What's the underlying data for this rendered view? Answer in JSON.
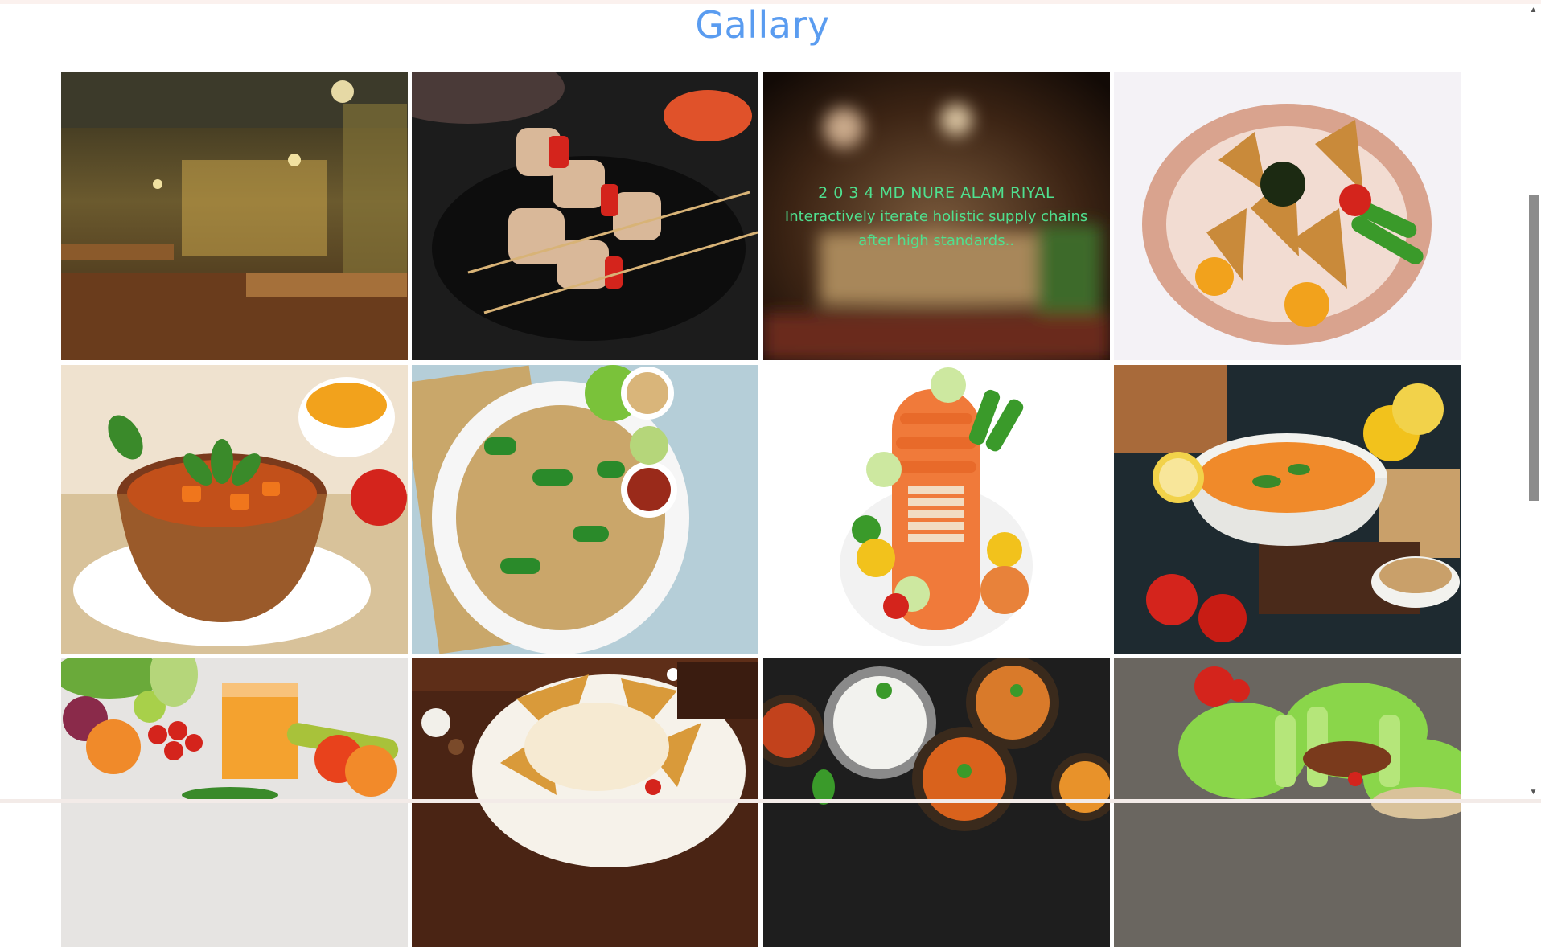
{
  "gallery": {
    "title": "Gallary",
    "overlay": {
      "name": "2 0 3 4 MD NURE ALAM RIYAL",
      "description": "Interactively iterate holistic supply chains after high standards.."
    },
    "images": [
      {
        "name": "restaurant-interior-image"
      },
      {
        "name": "chicken-skewers-image"
      },
      {
        "name": "blurred-table-image"
      },
      {
        "name": "samosa-plate-image"
      },
      {
        "name": "vegetable-stew-bowl-image"
      },
      {
        "name": "stir-fry-noodles-image"
      },
      {
        "name": "vegetable-platter-image"
      },
      {
        "name": "lentil-soup-image"
      },
      {
        "name": "fruit-juice-image"
      },
      {
        "name": "nachos-cheese-image"
      },
      {
        "name": "curry-rice-spread-image"
      },
      {
        "name": "lettuce-wraps-image"
      }
    ]
  },
  "scrollbar": {
    "up_glyph": "▲",
    "down_glyph": "▼"
  }
}
